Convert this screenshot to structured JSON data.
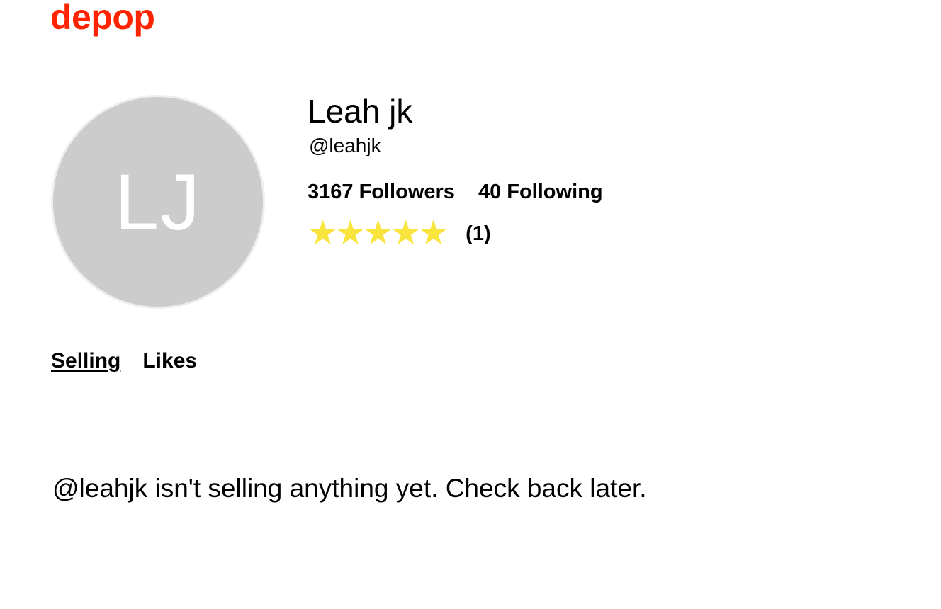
{
  "brand": {
    "logo_text": "depop",
    "color": "#ff2300"
  },
  "profile": {
    "initials": "LJ",
    "avatar_color": "#cccccc",
    "display_name": "Leah jk",
    "username": "@leahjk",
    "followers_label": "3167 Followers",
    "following_label": "40 Following",
    "rating": {
      "stars": 5,
      "max_stars": 5,
      "star_glyph": "★",
      "star_color": "#f8e43d",
      "review_count_label": "(1)"
    }
  },
  "tabs": [
    {
      "label": "Selling",
      "active": true
    },
    {
      "label": "Likes",
      "active": false
    }
  ],
  "empty_state": {
    "message": "@leahjk isn't selling anything yet. Check back later."
  }
}
